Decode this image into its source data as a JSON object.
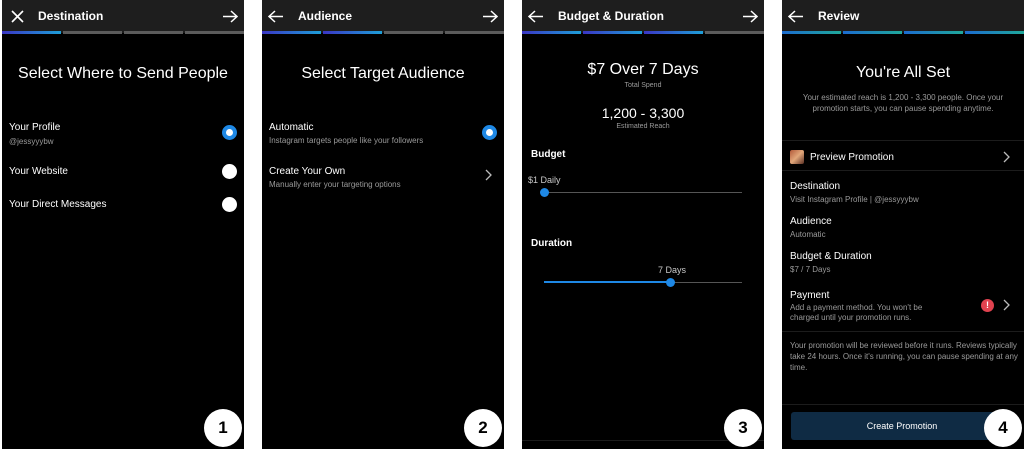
{
  "panel1": {
    "title": "Destination",
    "heading": "Select Where to Send People",
    "options": [
      {
        "label": "Your Profile",
        "sub": "@jessyyybw",
        "selected": true
      },
      {
        "label": "Your Website",
        "selected": false
      },
      {
        "label": "Your Direct Messages",
        "selected": false
      }
    ],
    "step": "1"
  },
  "panel2": {
    "title": "Audience",
    "heading": "Select Target Audience",
    "options": [
      {
        "label": "Automatic",
        "sub": "Instagram targets people like your followers",
        "selected": true
      },
      {
        "label": "Create Your Own",
        "sub": "Manually enter your targeting options"
      }
    ],
    "step": "2"
  },
  "panel3": {
    "title": "Budget & Duration",
    "total": "$7 Over 7 Days",
    "total_label": "Total Spend",
    "reach": "1,200 - 3,300",
    "reach_label": "Estimated Reach",
    "budget_label": "Budget",
    "budget_value": "$1 Daily",
    "budget_level": 0,
    "duration_label": "Duration",
    "duration_value": "7 Days",
    "duration_level": 0.64,
    "step": "3"
  },
  "panel4": {
    "title": "Review",
    "heading": "You're All Set",
    "summary": "Your estimated reach is 1,200 - 3,300 people. Once your promotion starts, you can pause spending anytime.",
    "preview": "Preview Promotion",
    "destination_label": "Destination",
    "destination_value": "Visit Instagram Profile | @jessyyybw",
    "audience_label": "Audience",
    "audience_value": "Automatic",
    "budget_label": "Budget & Duration",
    "budget_value": "$7 / 7 Days",
    "payment_label": "Payment",
    "payment_value": "Add a payment method. You won't be charged until your promotion runs.",
    "warning_glyph": "!",
    "notice": "Your promotion will be reviewed before it runs. Reviews typically take 24 hours. Once it's running, you can pause spending at any time.",
    "cta": "Create Promotion",
    "step": "4"
  },
  "colors": {
    "accent": "#1e88e5",
    "warning": "#e0424f",
    "cta": "#0f2b44",
    "background": "#000000",
    "header": "#1e1e1e"
  }
}
